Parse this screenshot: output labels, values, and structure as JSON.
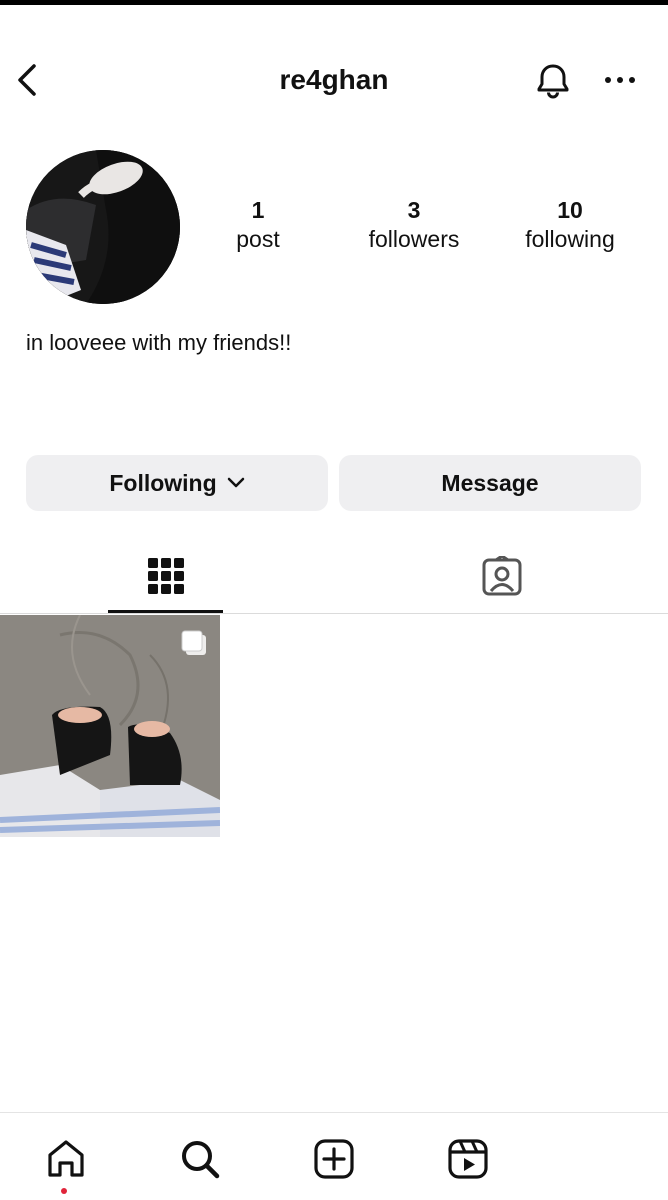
{
  "header": {
    "username": "re4ghan",
    "icons": {
      "back": "chevron-left-icon",
      "bell": "bell-icon",
      "more": "ellipsis-icon"
    }
  },
  "stats": {
    "posts": {
      "value": "1",
      "label": "post"
    },
    "followers": {
      "value": "3",
      "label": "followers"
    },
    "following": {
      "value": "10",
      "label": "following"
    }
  },
  "bio": "in looveee with my friends!!",
  "actions": {
    "following_label": "Following",
    "message_label": "Message"
  },
  "tabs": [
    {
      "name": "grid",
      "icon": "grid-icon",
      "active": true
    },
    {
      "name": "tagged",
      "icon": "tagged-person-icon",
      "active": false
    }
  ],
  "posts": [
    {
      "type": "carousel",
      "icon": "multiple-images-icon"
    }
  ],
  "bottom_nav": [
    {
      "name": "home",
      "icon": "home-icon",
      "notification_dot": true
    },
    {
      "name": "search",
      "icon": "search-icon"
    },
    {
      "name": "create",
      "icon": "plus-square-icon"
    },
    {
      "name": "reels",
      "icon": "reels-icon"
    }
  ],
  "colors": {
    "button_bg": "#efeff1",
    "notification_dot": "#e0243a",
    "divider": "#dbdbdb"
  }
}
